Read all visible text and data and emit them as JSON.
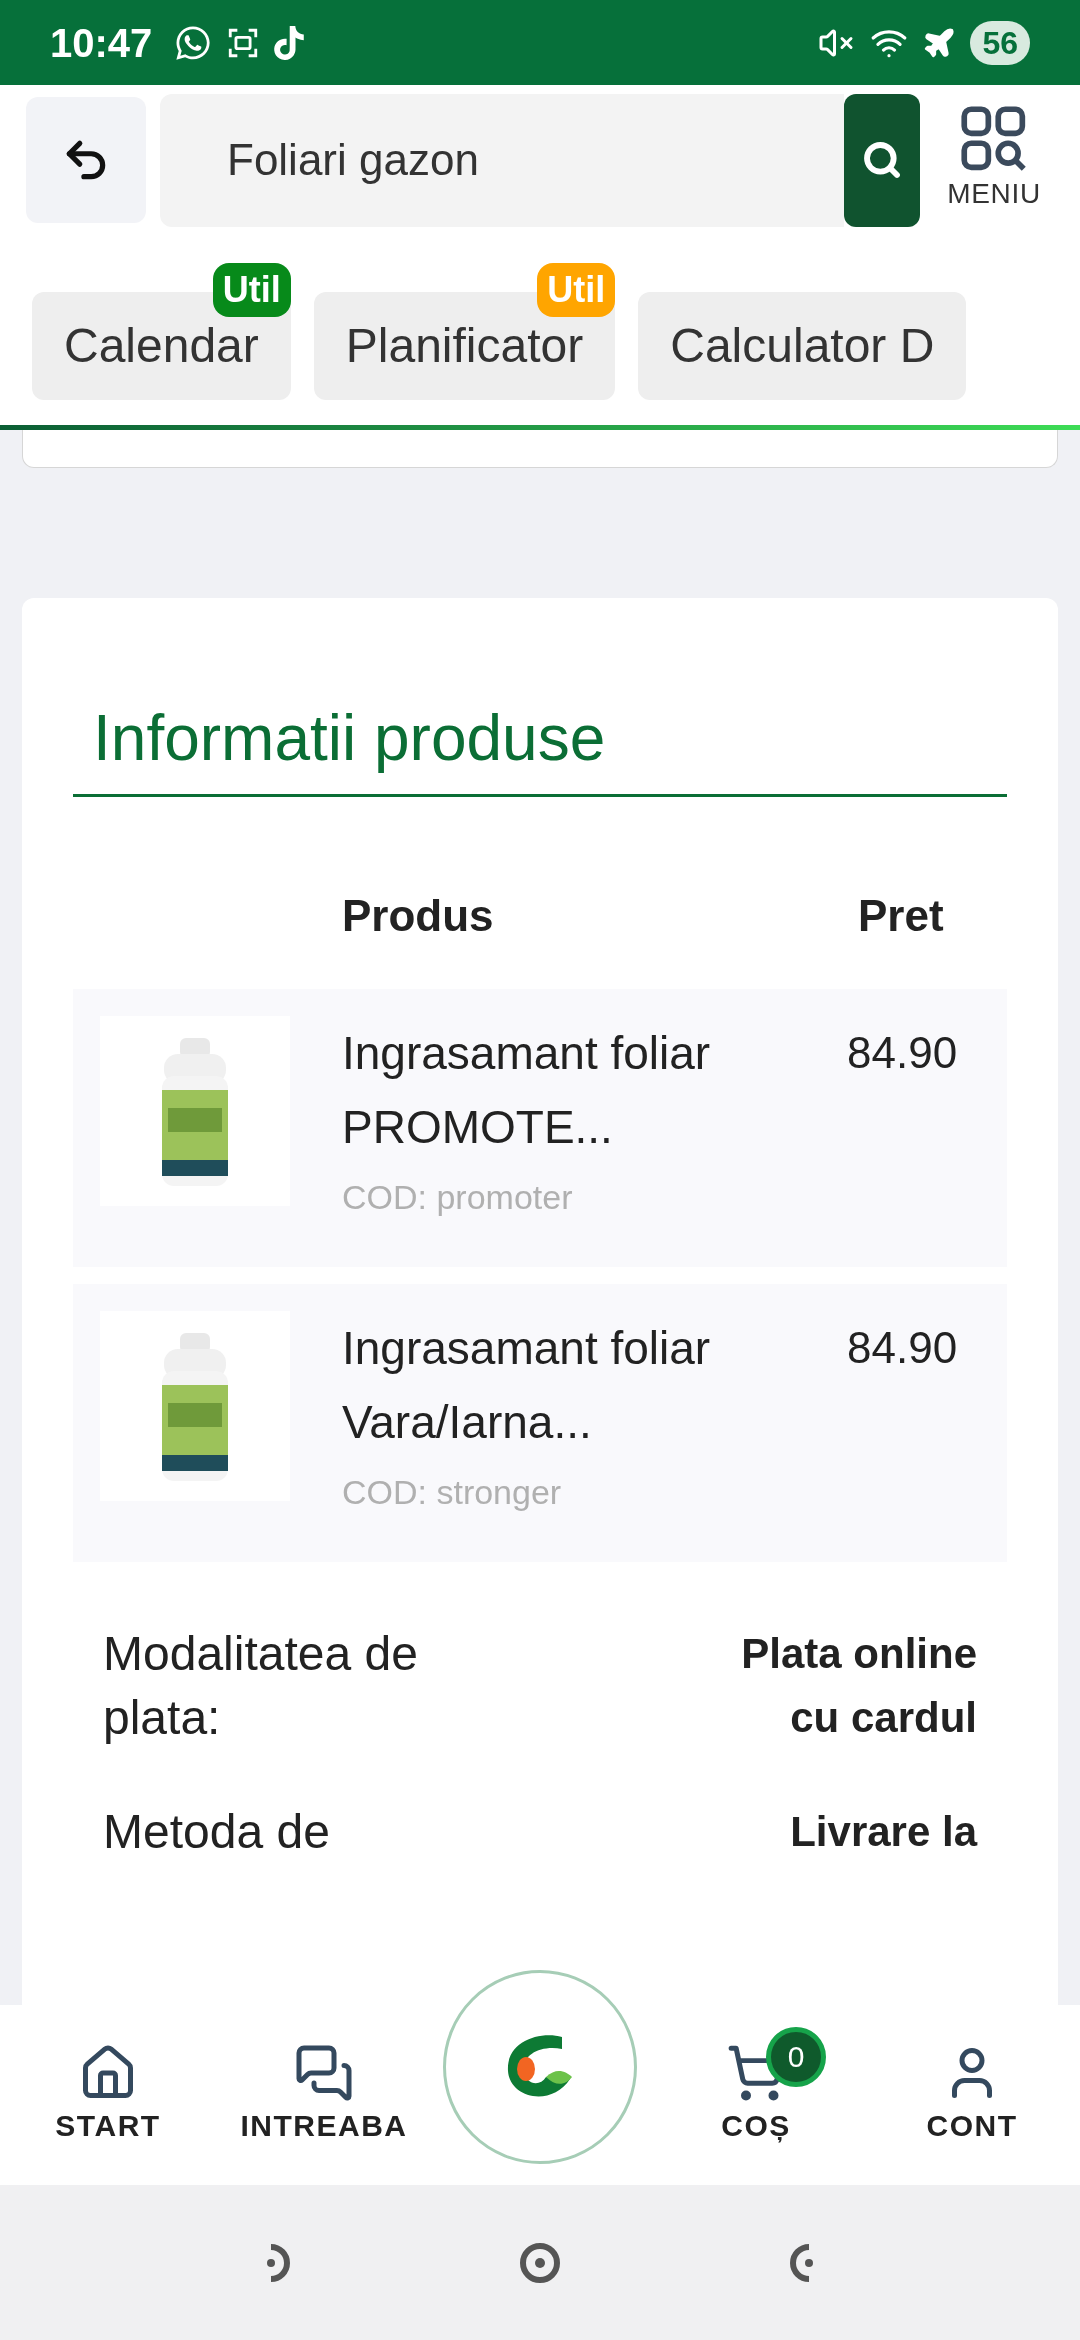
{
  "status_bar": {
    "time": "10:47",
    "battery": "56"
  },
  "header": {
    "search": {
      "value": "Foliari gazon"
    },
    "menu_label": "MENIU"
  },
  "tabs": [
    {
      "label": "Calendar",
      "badge": "Util",
      "color": "#078a1a"
    },
    {
      "label": "Planificator",
      "badge": "Util",
      "color": "#ffa500"
    },
    {
      "label": "Calculator D"
    }
  ],
  "section": {
    "title": "Informatii produse",
    "columns": [
      "Produs",
      "Pret"
    ]
  },
  "products": [
    {
      "name": "Ingrasamant foliar PROMOTE...",
      "code": "COD: promoter",
      "price": "84.90"
    },
    {
      "name": "Ingrasamant foliar Vara/Iarna...",
      "code": "COD: stronger",
      "price": "84.90"
    }
  ],
  "order_details": [
    {
      "label": "Modalitatea de plata:",
      "value": "Plata online cu cardul"
    },
    {
      "label": "Metoda de",
      "value": "Livrare la"
    }
  ],
  "bottom_nav": [
    {
      "kind": "home",
      "label": "START"
    },
    {
      "kind": "question",
      "label": "INTREABA"
    },
    {
      "kind": "logo"
    },
    {
      "kind": "cart",
      "label": "COȘ",
      "count": "0"
    },
    {
      "kind": "account",
      "label": "CONT"
    }
  ]
}
